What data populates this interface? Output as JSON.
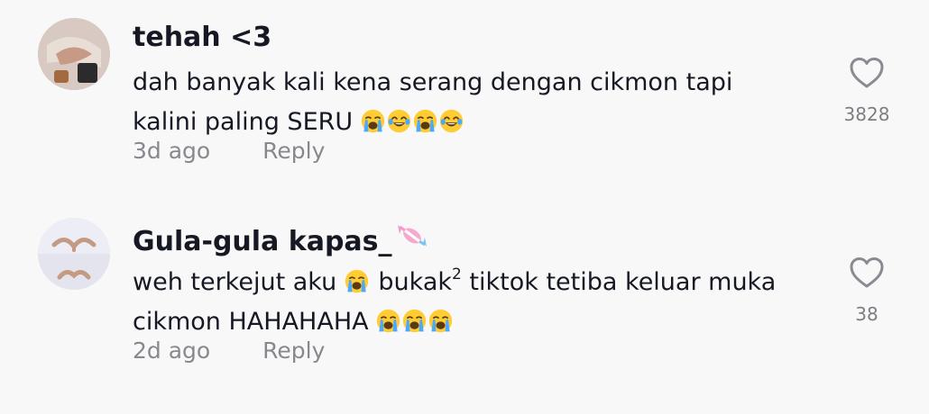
{
  "comments": [
    {
      "username": "tehah <3",
      "text_line1": "dah banyak kali kena serang dengan cikmon tapi",
      "text_line2": "kalini paling SERU",
      "time": "3d ago",
      "reply_label": "Reply",
      "likes": "3828",
      "emojis": [
        "loudly-crying-face-emoji",
        "tears-of-joy-emoji",
        "loudly-crying-face-emoji",
        "tears-of-joy-emoji"
      ]
    },
    {
      "username": "Gula-gula kapas_",
      "username_icon": "candy-icon",
      "text_line1_a": "weh terkejut aku",
      "text_line1_b": "bukak",
      "text_line1_sup": "2",
      "text_line1_c": "tiktok tetiba keluar muka",
      "text_line2": "cikmon HAHAHAHA",
      "time": "2d ago",
      "reply_label": "Reply",
      "likes": "38",
      "emojis": [
        "loudly-crying-face-emoji",
        "loudly-crying-face-emoji",
        "loudly-crying-face-emoji",
        "loudly-crying-face-emoji"
      ]
    }
  ],
  "colors": {
    "background": "#f8f8f8",
    "primary_text": "#161823",
    "secondary_text": "#8a8b91",
    "heart_outline": "#8a8b91"
  }
}
